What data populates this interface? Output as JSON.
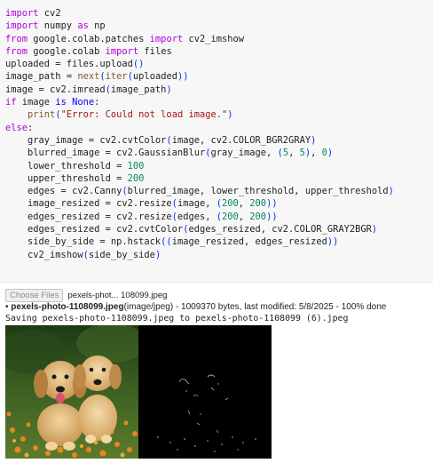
{
  "code": {
    "lines": [
      "import cv2",
      "import numpy as np",
      "from google.colab.patches import cv2_imshow",
      "from google.colab import files",
      "uploaded = files.upload()",
      "image_path = next(iter(uploaded))",
      "image = cv2.imread(image_path)",
      "if image is None:",
      "    print(\"Error: Could not load image.\")",
      "else:",
      "    gray_image = cv2.cvtColor(image, cv2.COLOR_BGR2GRAY)",
      "    blurred_image = cv2.GaussianBlur(gray_image, (5, 5), 0)",
      "    lower_threshold = 100",
      "    upper_threshold = 200",
      "    edges = cv2.Canny(blurred_image, lower_threshold, upper_threshold)",
      "    image_resized = cv2.resize(image, (200, 200))",
      "    edges_resized = cv2.resize(edges, (200, 200))",
      "    edges_resized = cv2.cvtColor(edges_resized, cv2.COLOR_GRAY2BGR)",
      "    side_by_side = np.hstack((image_resized, edges_resized))",
      "    cv2_imshow(side_by_side)"
    ]
  },
  "output": {
    "choose_button": "Choose Files",
    "file_short": "pexels-phot... 108099.jpeg",
    "bullet": "•",
    "file_name": "pexels-photo-1108099.jpeg",
    "file_meta": "(image/jpeg) - 1009370 bytes, last modified: 5/8/2025 - 100% done",
    "saving": "Saving pexels-photo-1108099.jpeg to pexels-photo-1108099 (6).jpeg"
  },
  "colors": {
    "keyword": "#af00db",
    "function": "#795e26",
    "number": "#098658",
    "string": "#a31515",
    "cell_background": "#f7f7f7"
  }
}
